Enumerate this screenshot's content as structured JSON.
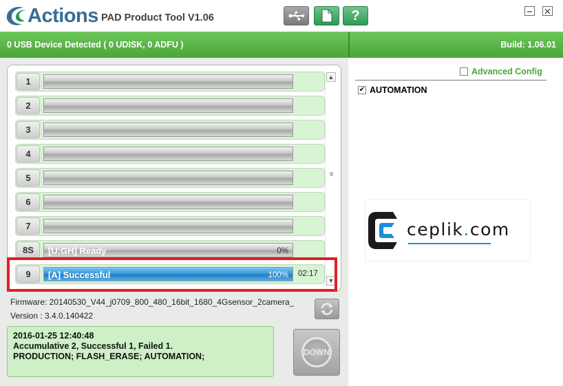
{
  "app": {
    "brand": "Actions",
    "title": "PAD Product Tool V1.06"
  },
  "toolbar": {
    "usb_icon": "usb-icon",
    "doc_icon": "document-icon",
    "help_label": "?"
  },
  "window": {
    "minimize_icon": "minimize-icon",
    "close_icon": "close-icon"
  },
  "status": {
    "devices": "0 USB Device Detected ( 0 UDISK, 0 ADFU )",
    "build": "Build: 1.06.01"
  },
  "slots": [
    {
      "num": "1",
      "label": "",
      "percent": "",
      "time": "",
      "progress": 0
    },
    {
      "num": "2",
      "label": "",
      "percent": "",
      "time": "",
      "progress": 0
    },
    {
      "num": "3",
      "label": "",
      "percent": "",
      "time": "",
      "progress": 0
    },
    {
      "num": "4",
      "label": "",
      "percent": "",
      "time": "",
      "progress": 0
    },
    {
      "num": "5",
      "label": "",
      "percent": "",
      "time": "",
      "progress": 0
    },
    {
      "num": "6",
      "label": "",
      "percent": "",
      "time": "",
      "progress": 0
    },
    {
      "num": "7",
      "label": "",
      "percent": "",
      "time": "",
      "progress": 0
    },
    {
      "num": "8S",
      "label": "[U:GH] Ready",
      "percent": "0%",
      "time": "",
      "progress": 0
    },
    {
      "num": "9",
      "label": "[A] Successful",
      "percent": "100%",
      "time": "02:17",
      "progress": 100
    }
  ],
  "firmware": {
    "firmware": "Firmware: 20140530_V44_j0709_800_480_16bit_1680_4Gsensor_2camera_",
    "version": "Version : 3.4.0.140422"
  },
  "log": {
    "line1": "2016-01-25 12:40:48",
    "line2": "Accumulative 2, Successful 1, Failed 1.",
    "line3": "PRODUCTION; FLASH_ERASE; AUTOMATION;"
  },
  "actions": {
    "down_label": "DOWN"
  },
  "options": {
    "advanced_config": "Advanced Config",
    "advanced_config_checked": false,
    "automation": "AUTOMATION",
    "automation_checked": true
  },
  "watermark": {
    "text_before": "ceplik",
    "text_dot": ".",
    "text_after": "com"
  },
  "colors": {
    "status_green": "#4aa63a",
    "panel_green": "#d9f3d5",
    "progress_blue": "#3b9ad9",
    "highlight_red": "#e01e26",
    "brand_blue": "#3a6d93"
  }
}
